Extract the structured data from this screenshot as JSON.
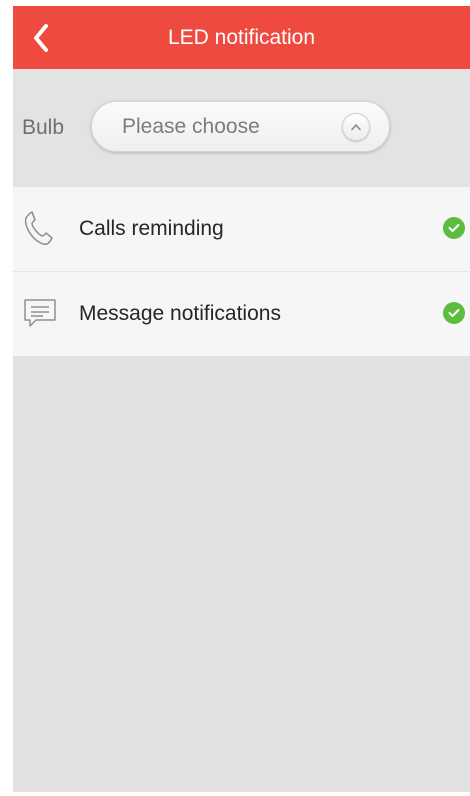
{
  "app_bar": {
    "title": "LED notification",
    "back_icon": "chevron-left-icon",
    "color": "#ee4a3f"
  },
  "bulb": {
    "label": "Bulb",
    "placeholder": "Please choose",
    "toggle_icon": "chevron-up-icon"
  },
  "list": {
    "items": [
      {
        "icon": "phone-icon",
        "label": "Calls reminding",
        "checked": true
      },
      {
        "icon": "message-icon",
        "label": "Message notifications",
        "checked": true
      }
    ],
    "check_color": "#5cbd3e"
  },
  "colors": {
    "background": "#e2e2e2",
    "list_background": "#f6f6f6"
  }
}
